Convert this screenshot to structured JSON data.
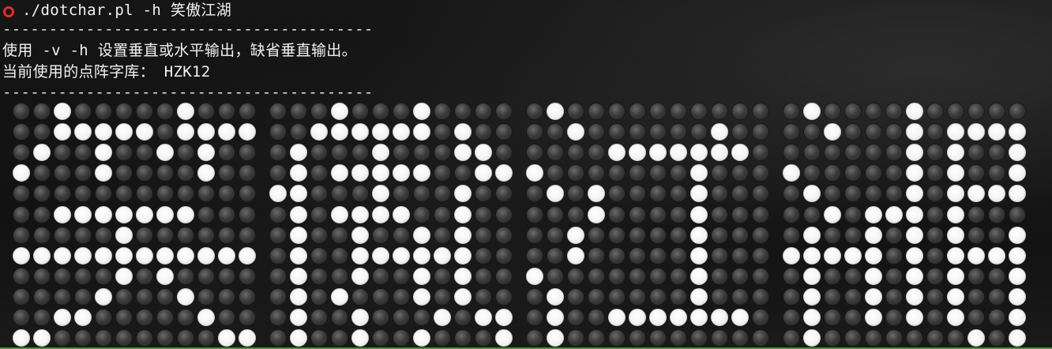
{
  "terminal": {
    "command": "./dotchar.pl -h 笑傲江湖",
    "separator": "----------------------------------------",
    "info_line1": "使用 -v -h 设置垂直或水平输出，缺省垂直输出。",
    "info_line2": "当前使用的点阵字库： HZK12",
    "colors": {
      "background": "#121212",
      "text": "#f2f2f2",
      "prompt_icon": "#e0301e",
      "dot_on": "#ffffff",
      "dot_off": "#3c3c3c"
    }
  },
  "dot_matrix": {
    "characters": [
      "笑",
      "傲",
      "江",
      "湖"
    ],
    "rows_per_char": 12,
    "cols_per_char": 12,
    "glyphs": [
      [
        "..#.....#...",
        "..#####.####",
        ".#..#..#.#..",
        "#...#....#..",
        "............",
        "..#######...",
        ".....#......",
        "############",
        ".....#.#....",
        "....#...#...",
        "..##.....#..",
        "##........##"
      ],
      [
        "...#...#....",
        "..######.#..",
        ".#...#...##.",
        ".#.#####..##",
        "##...#...#..",
        ".#.####..#..",
        ".#..#..#.#..",
        ".#..######..",
        ".#..#..#.#..",
        ".#.#...#.#..",
        ".#..#...#.##",
        ".#..#..#...#"
      ],
      [
        ".#..........",
        "..#......#..",
        "....#######.",
        "#.......#...",
        ".#.#....#...",
        "...#....#...",
        "..#.....#...",
        "..#.....#...",
        "#.......#...",
        ".#......#...",
        ".#..#######.",
        ".#.........."
      ],
      [
        ".#....#.....",
        "..#...#.####",
        "......#.#..#",
        "#.....#.#..#",
        ".#....#.####",
        "..#.###.#...",
        ".#..#.#.#..#",
        "#####.#.####",
        ".#..#.#.#..#",
        ".#..#.#.#..#",
        ".#..#.#.#..#",
        ".#.......#.#"
      ]
    ]
  }
}
